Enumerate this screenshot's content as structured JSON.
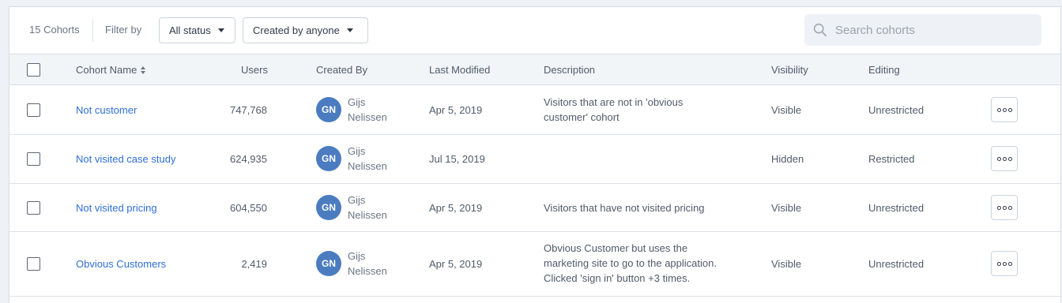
{
  "toolbar": {
    "count_label": "15 Cohorts",
    "filter_label": "Filter by",
    "status_filter": "All status",
    "created_filter": "Created by anyone",
    "search_placeholder": "Search cohorts"
  },
  "columns": {
    "name": "Cohort Name",
    "users": "Users",
    "created_by": "Created By",
    "last_modified": "Last Modified",
    "description": "Description",
    "visibility": "Visibility",
    "editing": "Editing"
  },
  "rows": [
    {
      "name": "Not customer",
      "users": "747,768",
      "avatar_initials": "GN",
      "creator_first": "Gijs",
      "creator_last": "Nelissen",
      "last_modified": "Apr 5, 2019",
      "description_lines": [
        "Visitors that are not in 'obvious",
        "customer' cohort"
      ],
      "visibility": "Visible",
      "editing": "Unrestricted"
    },
    {
      "name": "Not visited case study",
      "users": "624,935",
      "avatar_initials": "GN",
      "creator_first": "Gijs",
      "creator_last": "Nelissen",
      "last_modified": "Jul 15, 2019",
      "description_lines": [],
      "visibility": "Hidden",
      "editing": "Restricted"
    },
    {
      "name": "Not visited pricing",
      "users": "604,550",
      "avatar_initials": "GN",
      "creator_first": "Gijs",
      "creator_last": "Nelissen",
      "last_modified": "Apr 5, 2019",
      "description_lines": [
        "Visitors that have not visited pricing"
      ],
      "visibility": "Visible",
      "editing": "Unrestricted"
    },
    {
      "name": "Obvious Customers",
      "users": "2,419",
      "avatar_initials": "GN",
      "creator_first": "Gijs",
      "creator_last": "Nelissen",
      "last_modified": "Apr 5, 2019",
      "description_lines": [
        "Obvious Customer but uses the",
        "marketing site to go to the application.",
        "Clicked 'sign in' button +3 times."
      ],
      "visibility": "Visible",
      "editing": "Unrestricted"
    }
  ],
  "colors": {
    "link": "#2f6fd8",
    "avatar": "#4b7cc0",
    "header_bg": "#f2f5f8"
  },
  "icons": {
    "search": "search-icon",
    "more": "more-options-icon",
    "sort": "sort-icon",
    "caret": "caret-down-icon"
  }
}
